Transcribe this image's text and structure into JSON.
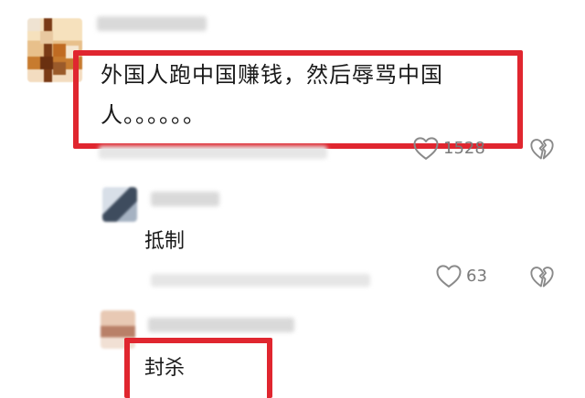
{
  "comments": [
    {
      "text": "外国人跑中国赚钱，然后辱骂中国人。。。。。。",
      "likes": "1528"
    },
    {
      "text": "抵制",
      "likes": "63"
    },
    {
      "text": "封杀"
    }
  ],
  "icons": {
    "like": "heart-outline-icon",
    "dislike": "broken-heart-icon"
  },
  "colors": {
    "highlight": "#e0262f",
    "meta_text": "#7a7a7a"
  }
}
